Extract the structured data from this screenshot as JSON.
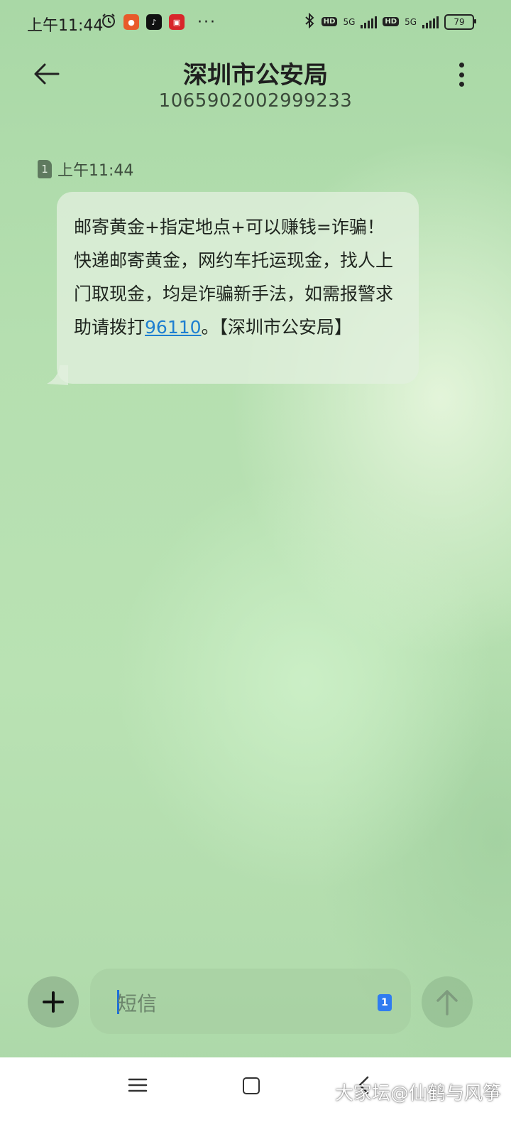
{
  "status_bar": {
    "time": "上午11:44",
    "network_1": "5G",
    "network_2": "5G",
    "hd": "HD",
    "battery": "79",
    "overflow": "···"
  },
  "header": {
    "title": "深圳市公安局",
    "number": "1065902002999233"
  },
  "message": {
    "sim_slot": "1",
    "time": "上午11:44",
    "text_before_link": "邮寄黄金+指定地点+可以赚钱=诈骗！快递邮寄黄金，网约车托运现金，找人上门取现金，均是诈骗新手法，如需报警求助请拨打",
    "link": "96110",
    "text_after_link": "。【深圳市公安局】"
  },
  "composer": {
    "placeholder": "短信",
    "sim_badge": "1"
  },
  "watermark": "大家坛@仙鹤与风筝",
  "icons": [
    "back-arrow-icon",
    "more-vertical-icon",
    "plus-icon",
    "send-arrow-icon",
    "nav-menu-icon",
    "nav-home-icon",
    "nav-back-icon",
    "bluetooth-icon",
    "alarm-icon"
  ],
  "colors": {
    "accent_link": "#1e7fd0",
    "sim_badge": "#2f7cf0"
  }
}
